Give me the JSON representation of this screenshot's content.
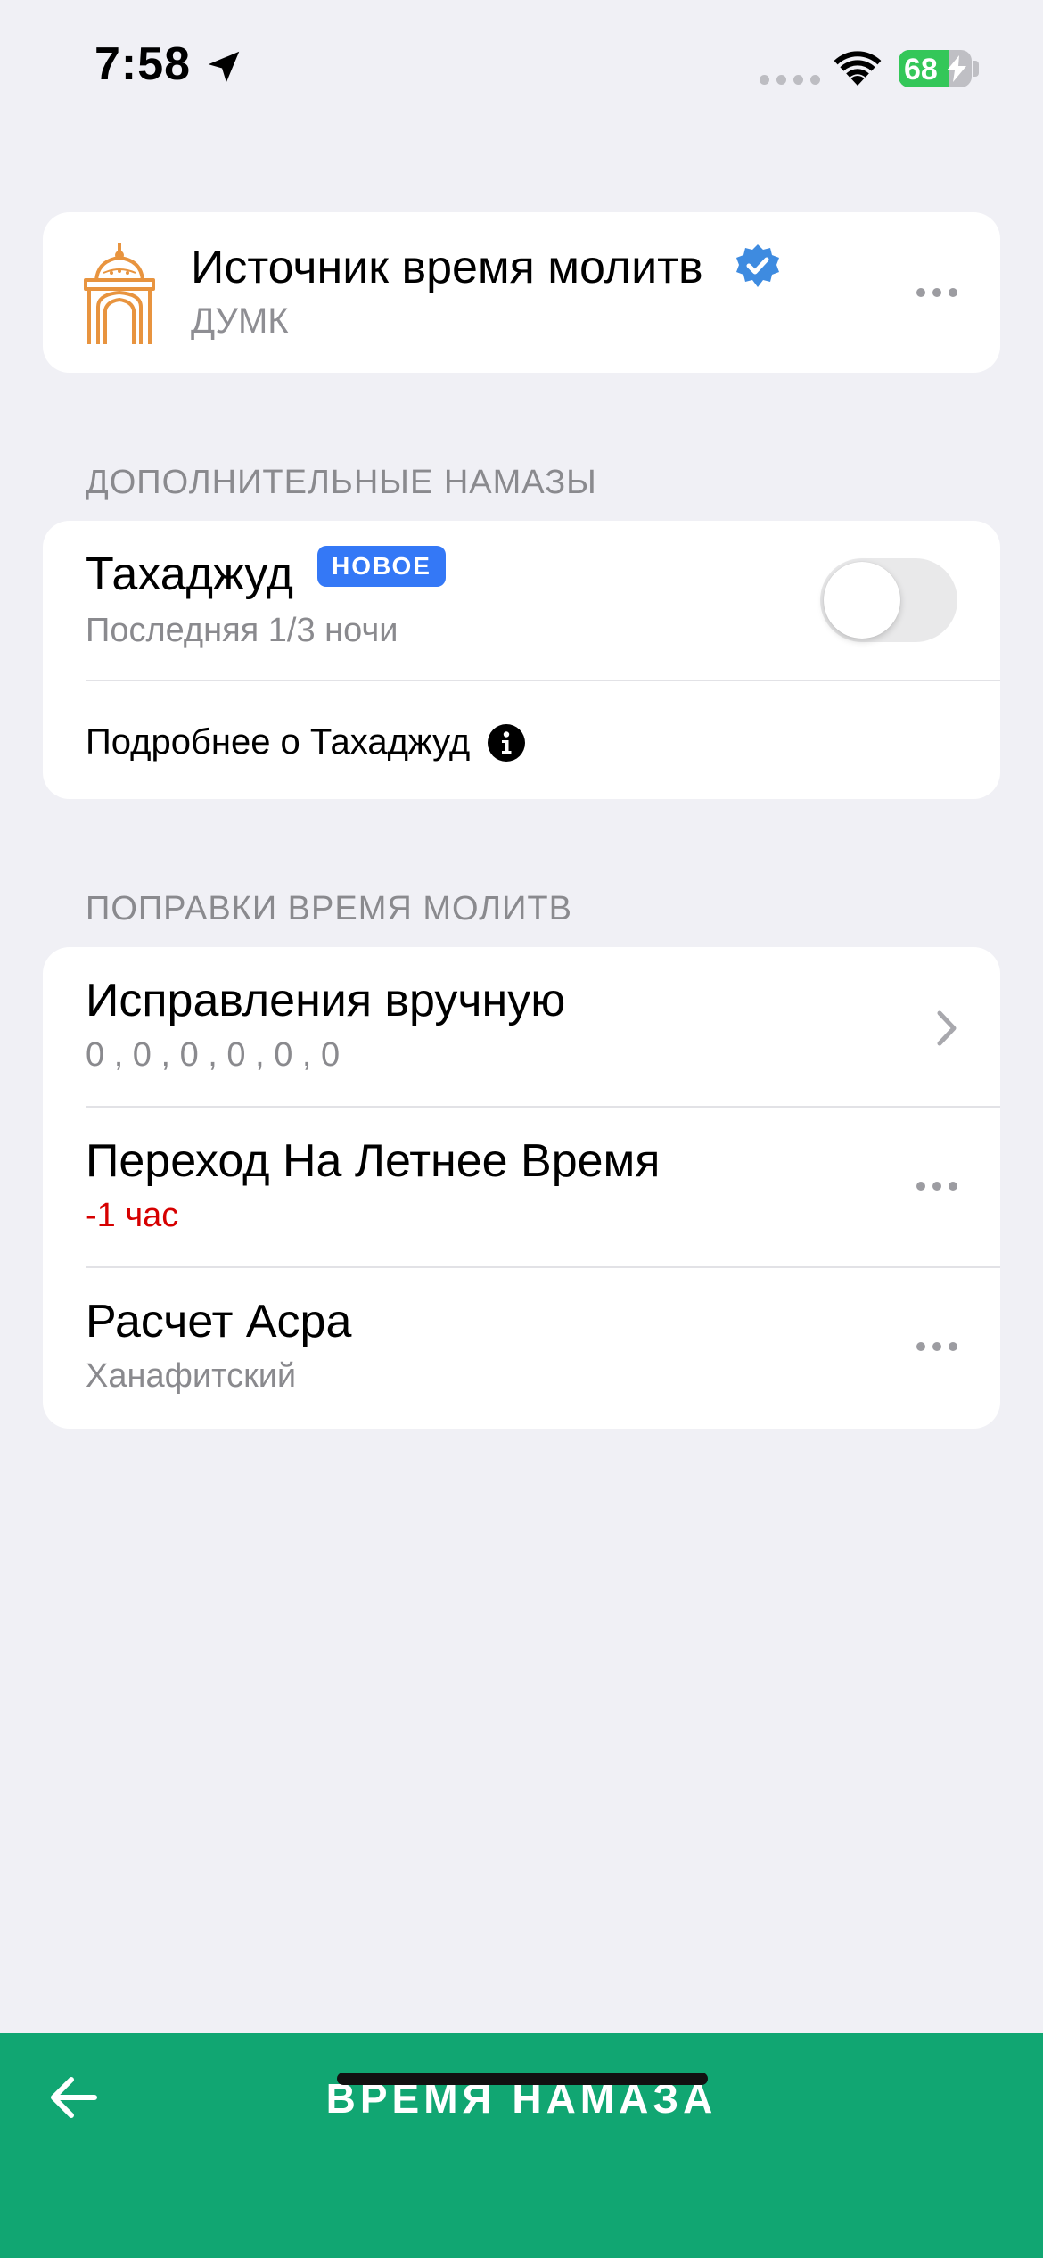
{
  "status_bar": {
    "time": "7:58",
    "battery": "68",
    "battery_level": 0.68
  },
  "source": {
    "title": "Источник время молитв",
    "subtitle": "ДУМК"
  },
  "extra_prayers": {
    "section_title": "ДОПОЛНИТЕЛЬНЫЕ НАМАЗЫ",
    "tahajjud": {
      "title": "Тахаджуд",
      "badge": "НОВОЕ",
      "subtitle": "Последняя 1/3 ночи",
      "enabled": false
    },
    "more_link": "Подробнее о Тахаджуд"
  },
  "corrections": {
    "section_title": "ПОПРАВКИ ВРЕМЯ МОЛИТВ",
    "items": [
      {
        "title": "Исправления вручную",
        "subtitle": "0 , 0 , 0 , 0 , 0 , 0",
        "accessory": "chevron"
      },
      {
        "title": "Переход На Летнее Время",
        "subtitle": "-1 час",
        "accessory": "more"
      },
      {
        "title": "Расчет Асра",
        "subtitle": "Ханафитский",
        "accessory": "more"
      }
    ]
  },
  "bottom_bar": {
    "title": "ВРЕМЯ НАМАЗА"
  },
  "colors": {
    "accent_green": "#11A672",
    "badge_blue": "#3478F6",
    "mosque_orange": "#E8943F",
    "dst_red": "#D60000"
  }
}
